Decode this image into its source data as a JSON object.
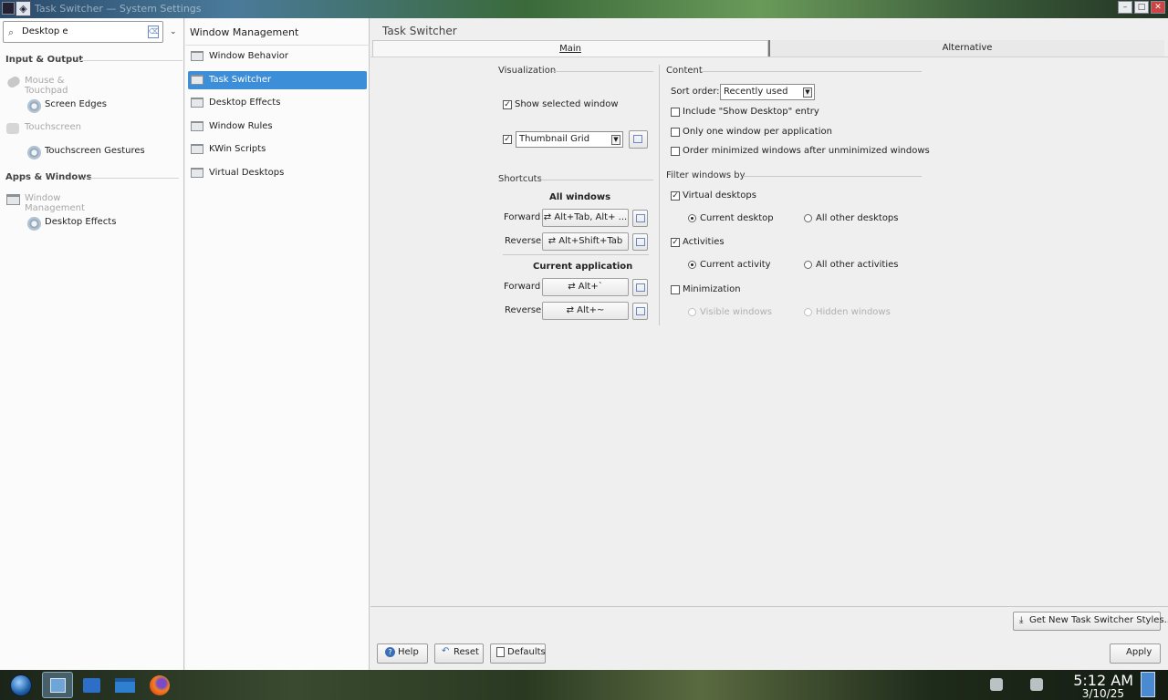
{
  "window": {
    "title": "Task Switcher — System Settings",
    "controls": [
      "minimize",
      "maximize",
      "close"
    ]
  },
  "sidebar": {
    "search_value": "Desktop e",
    "categories": [
      {
        "label": "Input & Output"
      },
      {
        "label": "Apps & Windows"
      }
    ],
    "items": [
      {
        "label": "Mouse & Touchpad",
        "dim": true
      },
      {
        "label": "Screen Edges",
        "dim": false
      },
      {
        "label": "Touchscreen",
        "dim": true
      },
      {
        "label": "Touchscreen Gestures",
        "dim": false
      },
      {
        "label": "Window Management",
        "dim": true
      },
      {
        "label": "Desktop Effects",
        "dim": false
      }
    ]
  },
  "midpanel": {
    "title": "Window Management",
    "items": [
      {
        "label": "Window Behavior",
        "selected": false
      },
      {
        "label": "Task Switcher",
        "selected": true
      },
      {
        "label": "Desktop Effects",
        "selected": false
      },
      {
        "label": "Window Rules",
        "selected": false
      },
      {
        "label": "KWin Scripts",
        "selected": false
      },
      {
        "label": "Virtual Desktops",
        "selected": false
      }
    ]
  },
  "content": {
    "title": "Task Switcher",
    "tabs": [
      {
        "label": "Main",
        "active": true
      },
      {
        "label": "Alternative",
        "active": false
      }
    ],
    "visualization": {
      "title": "Visualization",
      "show_selected_window": {
        "label": "Show selected window",
        "checked": true
      },
      "layout_enabled": true,
      "layout_value": "Thumbnail Grid"
    },
    "shortcuts": {
      "title": "Shortcuts",
      "all_windows_title": "All windows",
      "current_app_title": "Current application",
      "forward_label": "Forward",
      "reverse_label": "Reverse",
      "all_forward": "⇄  Alt+Tab, Alt+ ...",
      "all_reverse": "⇄  Alt+Shift+Tab",
      "app_forward": "⇄  Alt+`",
      "app_reverse": "⇄  Alt+~"
    },
    "content_group": {
      "title": "Content",
      "sort_order_label": "Sort order:",
      "sort_order_value": "Recently used",
      "include_show_desktop": {
        "label": "Include \"Show Desktop\" entry",
        "checked": false
      },
      "one_per_app": {
        "label": "Only one window per application",
        "checked": false
      },
      "order_minimized": {
        "label": "Order minimized windows after unminimized windows",
        "checked": false
      }
    },
    "filter": {
      "title": "Filter windows by",
      "virtual_desktops": {
        "label": "Virtual desktops",
        "checked": true
      },
      "current_desktop": {
        "label": "Current desktop",
        "selected": true
      },
      "all_other_desktops": {
        "label": "All other desktops",
        "selected": false
      },
      "activities": {
        "label": "Activities",
        "checked": true
      },
      "current_activity": {
        "label": "Current activity",
        "selected": true
      },
      "all_other_activities": {
        "label": "All other activities",
        "selected": false
      },
      "minimization": {
        "label": "Minimization",
        "checked": false
      },
      "visible_windows": {
        "label": "Visible windows",
        "enabled": false
      },
      "hidden_windows": {
        "label": "Hidden windows",
        "enabled": false
      }
    },
    "get_new_label": "Get New Task Switcher Styles...",
    "footer": {
      "help": "Help",
      "reset": "Reset",
      "defaults": "Defaults",
      "apply": "Apply"
    }
  },
  "taskbar": {
    "time": "5:12 AM",
    "date": "3/10/25",
    "pinned_icons": [
      "start-orb-icon",
      "kde-settings-icon",
      "store-icon",
      "file-explorer-icon",
      "firefox-icon"
    ]
  },
  "colors": {
    "selection": "#3d8ed8",
    "window_bg": "#efefef",
    "panel_bg": "#fbfbfb"
  }
}
